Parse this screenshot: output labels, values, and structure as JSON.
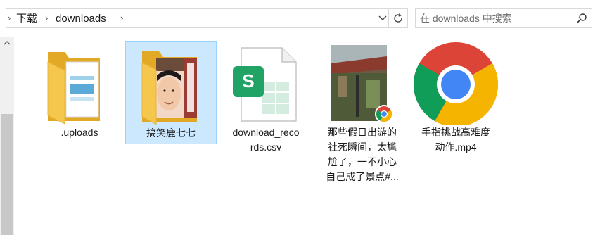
{
  "address_bar": {
    "crumbs": [
      "下载",
      "downloads"
    ]
  },
  "search": {
    "placeholder": "在 downloads 中搜索"
  },
  "files": [
    {
      "name": ".uploads",
      "type": "folder"
    },
    {
      "name": "搞笑鹿七七",
      "type": "folder-with-photo",
      "selected": true
    },
    {
      "name": "download_records.csv",
      "label_lines": [
        "download_reco",
        "rds.csv"
      ],
      "type": "csv"
    },
    {
      "name": "那些假日出游的社死瞬间，太尴尬了，一不小心自己成了景点#...",
      "label_lines": [
        "那些假日出游的",
        "社死瞬间，太尴",
        "尬了，一不小心",
        "自己成了景点#..."
      ],
      "type": "video-chrome"
    },
    {
      "name": "手指挑战高难度动作.mp4",
      "label_lines": [
        "手指挑战高难度",
        "动作.mp4"
      ],
      "type": "chrome"
    }
  ],
  "colors": {
    "selection_bg": "#cce8ff",
    "selection_border": "#99d1ff",
    "folder": "#f5c74d",
    "excel_green": "#21a366"
  }
}
